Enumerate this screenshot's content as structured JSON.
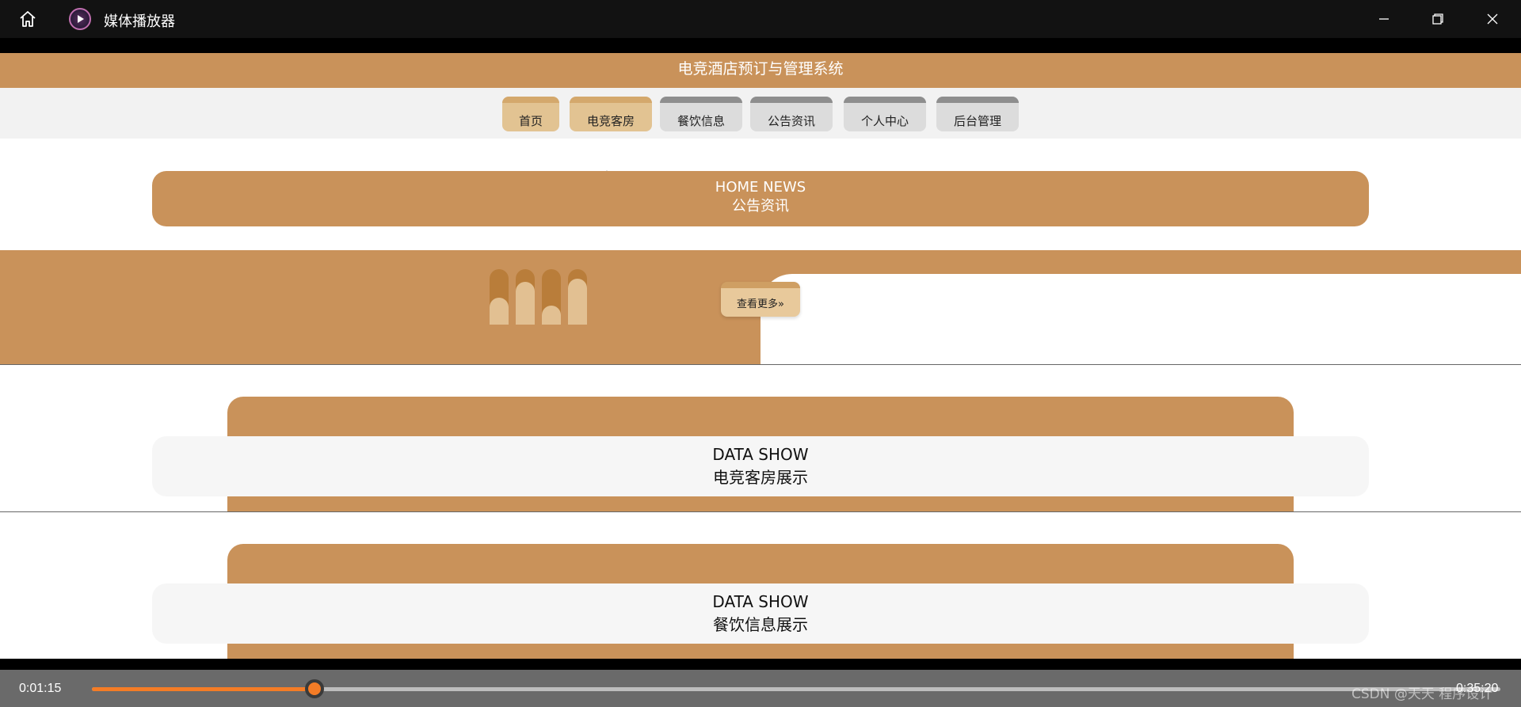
{
  "window": {
    "title": "媒体播放器",
    "icons": {
      "home": "home-icon",
      "app": "play-circle-icon",
      "minimize": "minimize-icon",
      "restore": "restore-icon",
      "close": "close-icon"
    }
  },
  "site": {
    "header_title": "电竞酒店预订与管理系统",
    "nav": [
      {
        "label": "首页",
        "active": true
      },
      {
        "label": "电竞客房",
        "active": true
      },
      {
        "label": "餐饮信息",
        "active": false
      },
      {
        "label": "公告资讯",
        "active": false
      },
      {
        "label": "个人中心",
        "active": false
      },
      {
        "label": "后台管理",
        "active": false
      }
    ],
    "news": {
      "title_en": "HOME NEWS",
      "title_cn": "公告资讯",
      "more_label": "查看更多»"
    },
    "sections": [
      {
        "title_en": "DATA SHOW",
        "title_cn": "电竞客房展示"
      },
      {
        "title_en": "DATA SHOW",
        "title_cn": "餐饮信息展示"
      }
    ]
  },
  "player": {
    "current_time": "0:01:15",
    "total_time": "0:35:20",
    "progress": 0.158,
    "watermark": "CSDN @天天 程序设计"
  },
  "colors": {
    "brand": "#c9925a",
    "accent": "#f47c26",
    "titlebar": "#121212"
  }
}
